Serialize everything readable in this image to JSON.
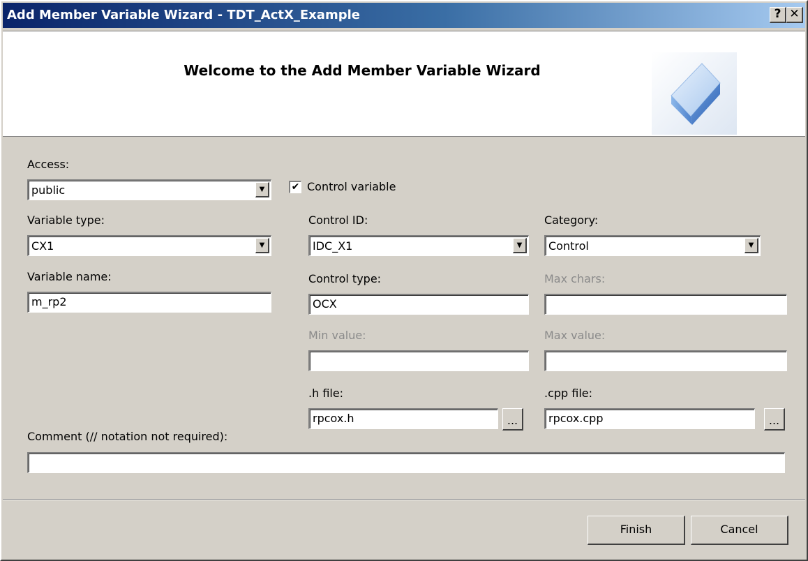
{
  "window": {
    "title": "Add Member Variable Wizard - TDT_ActX_Example"
  },
  "titlebar": {
    "help_label": "?",
    "close_label": "✕"
  },
  "banner": {
    "title": "Welcome to the Add Member Variable Wizard",
    "logo_icon": "wizard-cube-icon"
  },
  "form": {
    "access": {
      "label": "Access:",
      "value": "public"
    },
    "control_variable": {
      "label": "Control variable",
      "checked": true
    },
    "variable_type": {
      "label": "Variable type:",
      "value": "CX1"
    },
    "variable_name": {
      "label": "Variable name:",
      "value": "m_rp2"
    },
    "control_id": {
      "label": "Control ID:",
      "value": "IDC_X1"
    },
    "category": {
      "label": "Category:",
      "value": "Control"
    },
    "control_type": {
      "label": "Control type:",
      "value": "OCX"
    },
    "max_chars": {
      "label": "Max chars:",
      "value": ""
    },
    "min_value": {
      "label": "Min value:",
      "value": ""
    },
    "max_value": {
      "label": "Max value:",
      "value": ""
    },
    "h_file": {
      "label": ".h file:",
      "value": "rpcox.h",
      "browse_label": "..."
    },
    "cpp_file": {
      "label": ".cpp file:",
      "value": "rpcox.cpp",
      "browse_label": "..."
    },
    "comment": {
      "label": "Comment (// notation not required):",
      "value": ""
    }
  },
  "buttons": {
    "finish": "Finish",
    "cancel": "Cancel"
  },
  "colors": {
    "title_start": "#0a246a",
    "title_end": "#a6caf0",
    "face": "#d4d0c8"
  }
}
